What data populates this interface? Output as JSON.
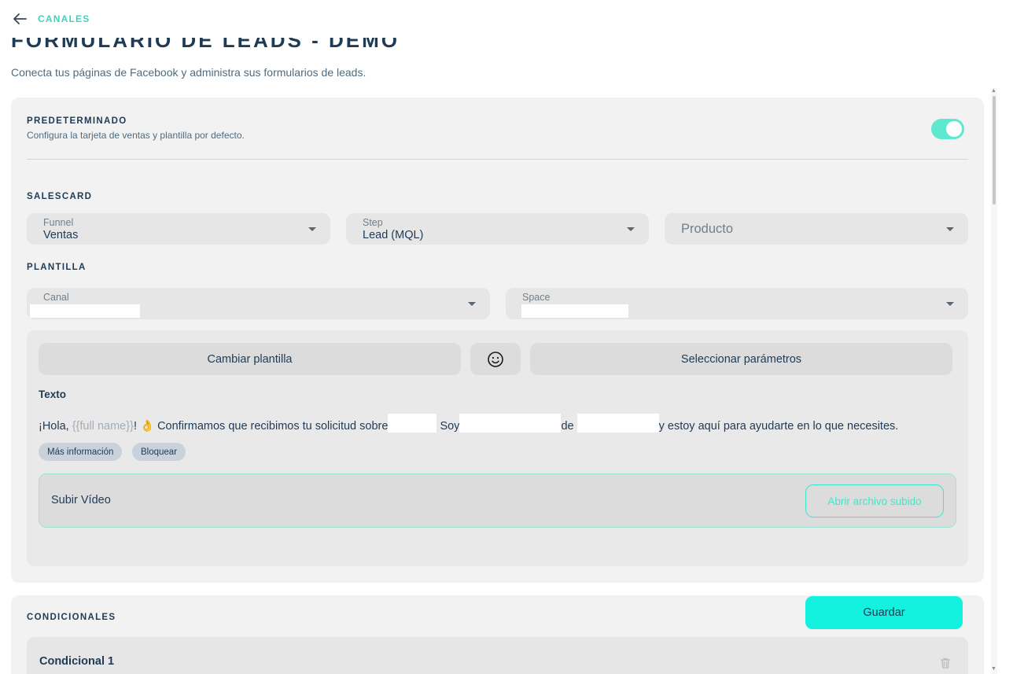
{
  "header": {
    "back_label": "CANALES"
  },
  "page": {
    "title": "FORMULARIO DE LEADS - DEMO",
    "subtitle": "Conecta tus páginas de Facebook y administra sus formularios de leads."
  },
  "default_section": {
    "title": "PREDETERMINADO",
    "hint": "Configura la tarjeta de ventas y plantilla por defecto.",
    "toggle_on": true
  },
  "salescard": {
    "title": "SALESCARD",
    "funnel": {
      "label": "Funnel",
      "value": "Ventas"
    },
    "step": {
      "label": "Step",
      "value": "Lead (MQL)"
    },
    "producto": {
      "placeholder": "Producto"
    }
  },
  "plantilla": {
    "title": "PLANTILLA",
    "canal": {
      "label": "Canal"
    },
    "space": {
      "label": "Space"
    },
    "change_template": "Cambiar plantilla",
    "select_params": "Seleccionar parámetros",
    "texto_label": "Texto",
    "message": {
      "greeting": "¡Hola, ",
      "variable": "{{full name}}",
      "part1": "! 👌 Confirmamos que recibimos tu solicitud sobre",
      "part2": " Soy",
      "part3": "de ",
      "part4": "y estoy aquí para ayudarte en lo que necesites."
    },
    "chips": [
      "Más información",
      "Bloquear"
    ],
    "upload_label": "Subir Vídeo",
    "open_file": "Abrir archivo subido"
  },
  "conditionals": {
    "title": "CONDICIONALES",
    "items": [
      "Condicional 1"
    ]
  },
  "actions": {
    "save": "Guardar"
  },
  "colors": {
    "accent": "#3fd3b8",
    "save_button": "#13f2de",
    "toggle": "#5de8cf",
    "text": "#1f3a55"
  }
}
